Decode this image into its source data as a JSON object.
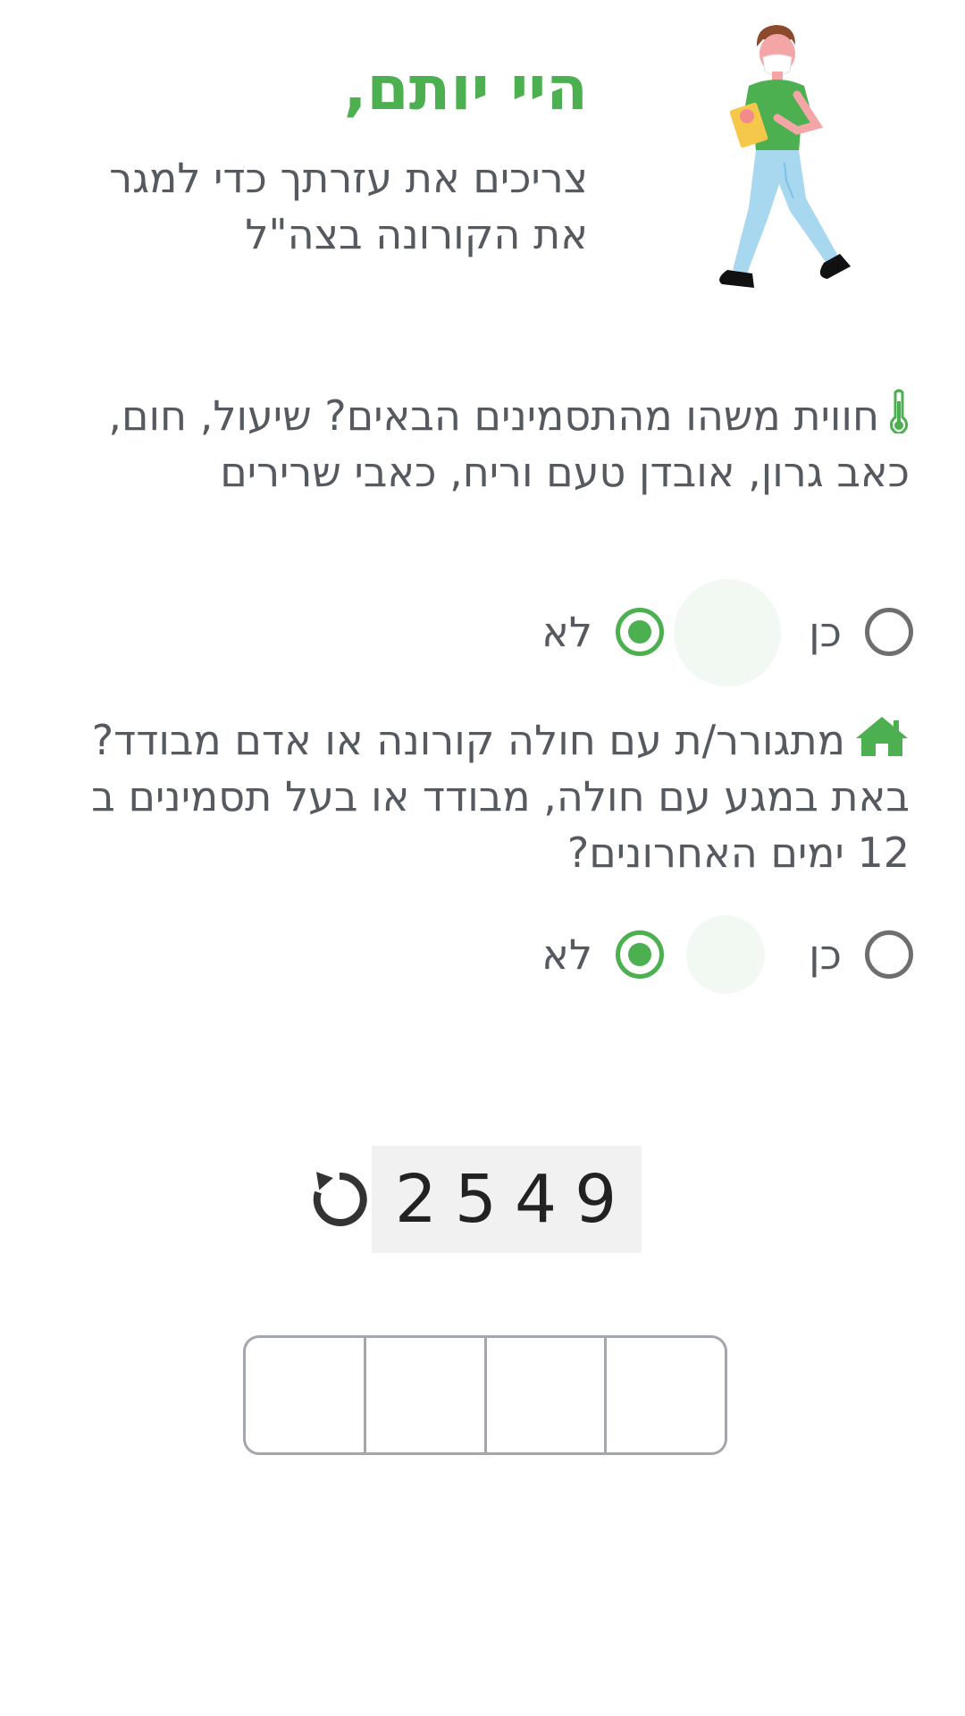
{
  "header": {
    "greeting": "היי יותם,",
    "subtitle": "צריכים את עזרתך כדי למגר את הקורונה בצה\"ל"
  },
  "questions": [
    {
      "icon": "thermometer-icon",
      "text": "חווית משהו מהתסמינים הבאים? שיעול, חום, כאב גרון, אובדן טעם וריח, כאבי שרירים",
      "options": [
        {
          "label": "כן",
          "checked": false
        },
        {
          "label": "לא",
          "checked": true
        }
      ]
    },
    {
      "icon": "home-icon",
      "text": "מתגורר/ת עם חולה קורונה או אדם מבודד? באת במגע עם חולה, מבודד או בעל תסמינים ב 12 ימים האחרונים?",
      "options": [
        {
          "label": "כן",
          "checked": false
        },
        {
          "label": "לא",
          "checked": true
        }
      ]
    }
  ],
  "captcha": {
    "code": "2549",
    "refresh_icon": "refresh-icon"
  },
  "code_input": {
    "cells": [
      "",
      "",
      "",
      ""
    ]
  },
  "colors": {
    "accent": "#4caf50",
    "text": "#555a60",
    "radio_unchecked": "#6e6e6e",
    "captcha_bg": "#f1f1f1",
    "input_border": "#a3a6ad"
  }
}
